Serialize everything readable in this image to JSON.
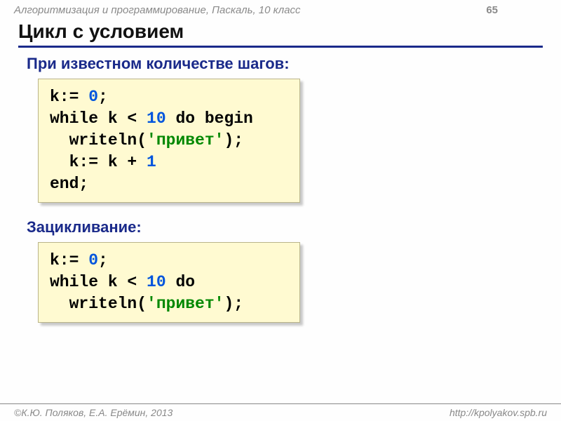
{
  "header": {
    "breadcrumb": "Алгоритмизация и программирование, Паскаль, 10 класс",
    "page_number": "65"
  },
  "title": "Цикл с условием",
  "section1": {
    "heading": "При известном количестве шагов:",
    "code": {
      "l1a": "k:= ",
      "l1n": "0",
      "l1b": ";",
      "l2a": "while k < ",
      "l2n": "10",
      "l2b": " do begin",
      "l3a": "  writeln(",
      "l3s": "'привет'",
      "l3b": ");",
      "l4a": "  k:= k + ",
      "l4n": "1",
      "l5": "end;"
    }
  },
  "section2": {
    "heading": "Зацикливание:",
    "code": {
      "l1a": "k:= ",
      "l1n": "0",
      "l1b": ";",
      "l2a": "while k < ",
      "l2n": "10",
      "l2b": " do",
      "l3a": "  writeln(",
      "l3s": "'привет'",
      "l3b": ");"
    }
  },
  "footer": {
    "left": "©К.Ю. Поляков, Е.А. Ерёмин, 2013",
    "right": "http://kpolyakov.spb.ru"
  }
}
